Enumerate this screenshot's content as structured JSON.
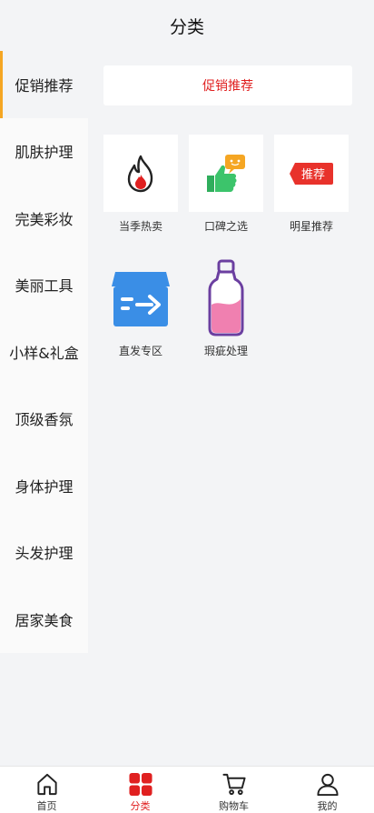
{
  "header": {
    "title": "分类"
  },
  "sidebar": {
    "items": [
      {
        "label": "促销推荐"
      },
      {
        "label": "肌肤护理"
      },
      {
        "label": "完美彩妆"
      },
      {
        "label": "美丽工具"
      },
      {
        "label": "小样&礼盒"
      },
      {
        "label": "顶级香氛"
      },
      {
        "label": "身体护理"
      },
      {
        "label": "头发护理"
      },
      {
        "label": "居家美食"
      }
    ]
  },
  "content": {
    "section_title": "促销推荐",
    "categories": [
      {
        "label": "当季热卖",
        "icon": "flame-icon"
      },
      {
        "label": "口碑之选",
        "icon": "thumbs-up-chat-icon"
      },
      {
        "label": "明星推荐",
        "icon": "recommend-tag-icon",
        "tag_text": "推荐"
      },
      {
        "label": "直发专区",
        "icon": "shipping-box-icon"
      },
      {
        "label": "瑕疵处理",
        "icon": "bottle-icon"
      }
    ]
  },
  "tabbar": {
    "items": [
      {
        "label": "首页",
        "icon": "home-icon"
      },
      {
        "label": "分类",
        "icon": "category-grid-icon"
      },
      {
        "label": "购物车",
        "icon": "cart-icon"
      },
      {
        "label": "我的",
        "icon": "user-icon"
      }
    ]
  },
  "colors": {
    "accent": "#e02020",
    "sidebar_indicator": "#f5a623"
  }
}
